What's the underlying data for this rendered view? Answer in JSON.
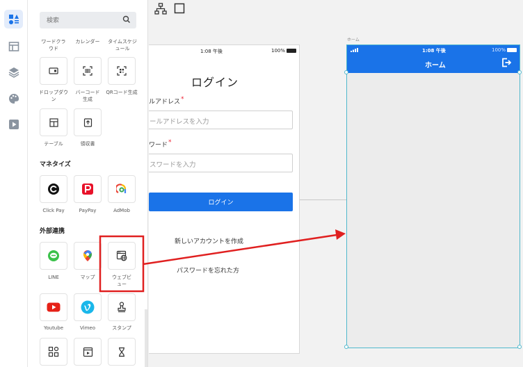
{
  "panel": {
    "search_placeholder": "検索",
    "row1": [
      "ワードクラウド",
      "カレンダー",
      "タイムスケジュール"
    ],
    "row2": [
      "ドロップダウン",
      "バーコード生成",
      "QRコード生成"
    ],
    "row3": [
      "テーブル",
      "領収書"
    ],
    "monetize_title": "マネタイズ",
    "monetize": [
      "Click Pay",
      "PayPay",
      "AdMob"
    ],
    "external_title": "外部連携",
    "external": [
      "LINE",
      "マップ",
      "ウェブビュー"
    ],
    "external2": [
      "Youtube",
      "Vimeo",
      "スタンプ"
    ]
  },
  "login": {
    "time": "1:08 午後",
    "battery": "100%",
    "title": "ログイン",
    "email_label": "ルアドレス",
    "email_placeholder": "ールアドレスを入力",
    "password_label": "ワード",
    "password_placeholder": "スワードを入力",
    "login_button": "ログイン",
    "create_account": "新しいアカウントを作成",
    "forgot_password": "パスワードを忘れた方"
  },
  "home": {
    "caption": "ホーム",
    "time": "1:08 午後",
    "battery": "100%",
    "title": "ホーム"
  },
  "colors": {
    "primary": "#1a73e8",
    "annotation": "#e02020",
    "selection": "#4fb8cc"
  }
}
